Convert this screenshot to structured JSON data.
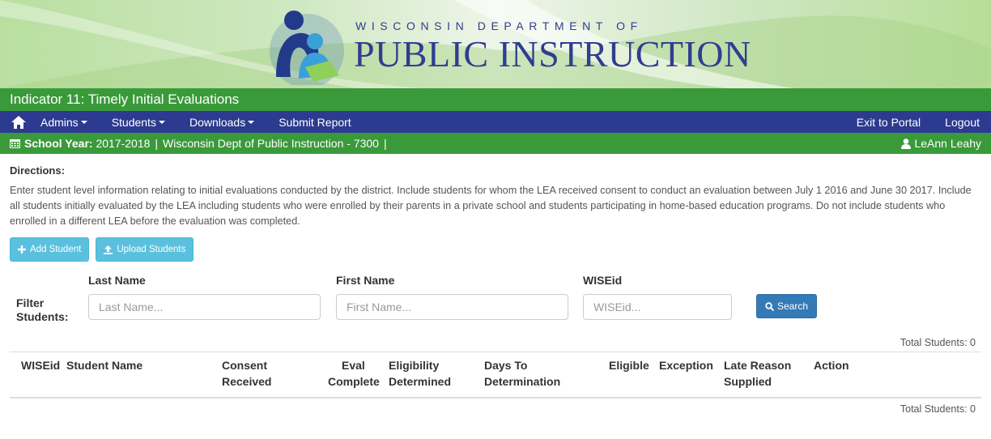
{
  "banner": {
    "line1": "WISCONSIN DEPARTMENT OF",
    "line2": "PUBLIC INSTRUCTION"
  },
  "title": "Indicator 11: Timely Initial Evaluations",
  "nav": {
    "items": [
      {
        "label": "Admins",
        "dropdown": true
      },
      {
        "label": "Students",
        "dropdown": true
      },
      {
        "label": "Downloads",
        "dropdown": true
      },
      {
        "label": "Submit Report",
        "dropdown": false
      }
    ],
    "right": [
      "Exit to Portal",
      "Logout"
    ]
  },
  "yearbar": {
    "label": "School Year:",
    "year": "2017-2018",
    "org": "Wisconsin Dept of Public Instruction - 7300",
    "user": "LeAnn Leahy"
  },
  "directions": {
    "title": "Directions:",
    "text": "Enter student level information relating to initial evaluations conducted by the district. Include students for whom the LEA received consent to conduct an evaluation between July 1 2016 and June 30 2017. Include all students initially evaluated by the LEA including students who were enrolled by their parents in a private school and students participating in home-based education programs. Do not include students who enrolled in a different LEA before the evaluation was completed."
  },
  "actions": {
    "add": "Add Student",
    "upload": "Upload Students"
  },
  "filter": {
    "label_line1": "Filter",
    "label_line2": "Students:",
    "last_name_label": "Last Name",
    "last_name_placeholder": "Last Name...",
    "first_name_label": "First Name",
    "first_name_placeholder": "First Name...",
    "wiseid_label": "WISEid",
    "wiseid_placeholder": "WISEid...",
    "search": "Search"
  },
  "table": {
    "total_top": "Total Students: 0",
    "total_bottom": "Total Students: 0",
    "headers": [
      [
        "WISEid"
      ],
      [
        "Student Name"
      ],
      [
        "Consent",
        "Received"
      ],
      [
        "Eval",
        "Complete"
      ],
      [
        "Eligibility",
        "Determined"
      ],
      [
        "Days To",
        "Determination"
      ],
      [
        "Eligible"
      ],
      [
        "Exception"
      ],
      [
        "Late Reason",
        "Supplied"
      ],
      [
        "Action"
      ]
    ]
  },
  "colors": {
    "green_bar": "#3a9a3a",
    "nav_blue": "#2c3b8f",
    "info_button": "#5bc0de",
    "primary_button": "#337ab7"
  }
}
